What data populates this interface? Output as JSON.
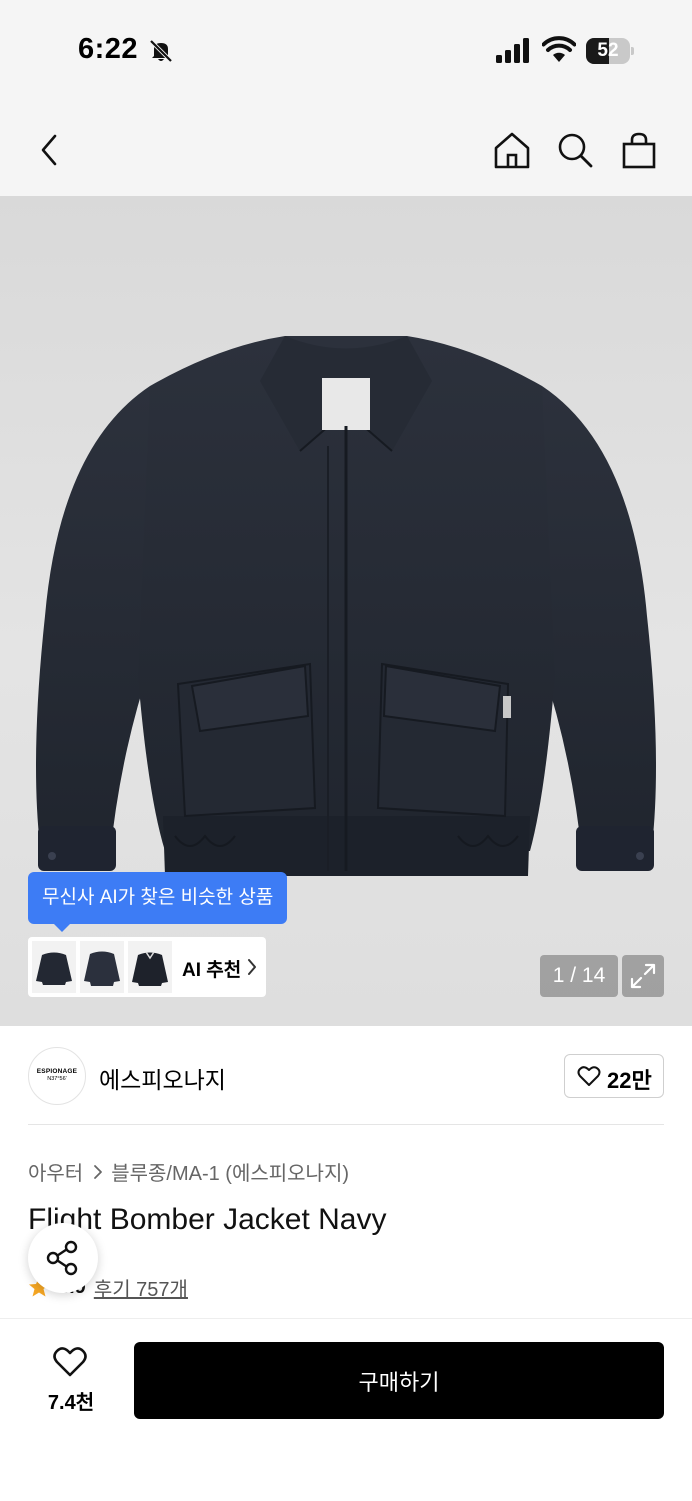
{
  "status_bar": {
    "time": "6:22",
    "battery": "52",
    "battery_level": 0.52
  },
  "nav": {
    "back_icon": "chevron-left-icon",
    "home_icon": "home-icon",
    "search_icon": "search-icon",
    "cart_icon": "shopping-bag-icon"
  },
  "gallery": {
    "ai_tooltip": "무신사 AI가 찾은 비슷한 상품",
    "ai_recommend_label": "AI 추천",
    "page_indicator": "1 / 14",
    "expand_icon": "expand-icon"
  },
  "brand": {
    "logo_text": "ESPIONAGE",
    "logo_subtext": "N37°56'",
    "name": "에스피오나지",
    "like_count": "22만"
  },
  "product": {
    "breadcrumb": [
      "아우터",
      "블루종/MA-1 (에스피오나지)"
    ],
    "title": "Flight Bomber Jacket Navy",
    "rating": "4.9",
    "reviews": "후기 757개"
  },
  "bottom_bar": {
    "like_count": "7.4천",
    "buy_label": "구매하기"
  },
  "colors": {
    "accent_blue": "#3d7cf5",
    "star": "#f5a623",
    "buy_button": "#000000"
  }
}
